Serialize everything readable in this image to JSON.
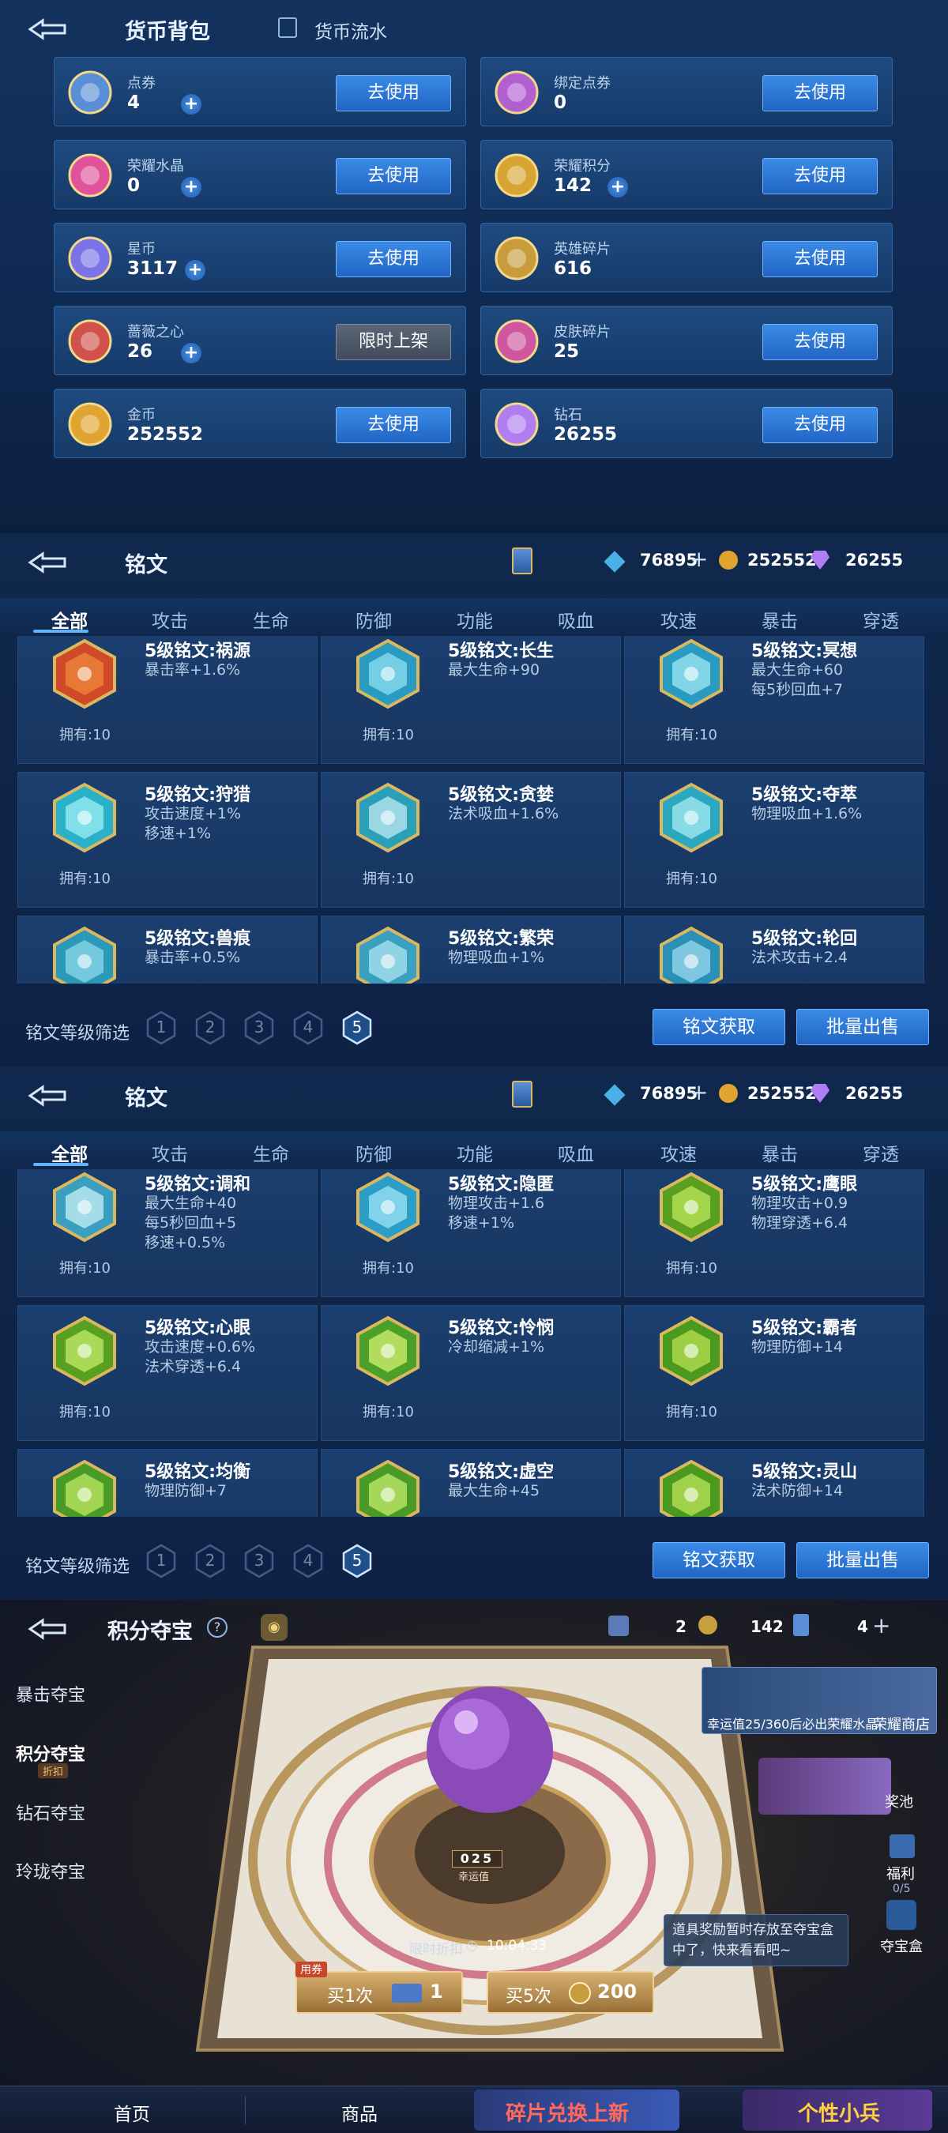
{
  "currency_panel": {
    "title": "货币背包",
    "flow_tab": "货币流水",
    "items": [
      {
        "name": "点券",
        "value": "4",
        "button": "去使用",
        "plus": true,
        "icon": "coupon-icon",
        "color": "#5a8fd8"
      },
      {
        "name": "绑定点券",
        "value": "0",
        "button": "去使用",
        "plus": false,
        "icon": "bound-coupon-icon",
        "color": "#b25fd0"
      },
      {
        "name": "荣耀水晶",
        "value": "0",
        "button": "去使用",
        "plus": true,
        "icon": "crystal-icon",
        "color": "#e0539a"
      },
      {
        "name": "荣耀积分",
        "value": "142",
        "button": "去使用",
        "plus": true,
        "icon": "honor-points-icon",
        "color": "#d9a532"
      },
      {
        "name": "星币",
        "value": "3117",
        "button": "去使用",
        "plus": true,
        "icon": "star-coin-icon",
        "color": "#7b74e8"
      },
      {
        "name": "英雄碎片",
        "value": "616",
        "button": "去使用",
        "plus": false,
        "icon": "hero-fragment-icon",
        "color": "#c89b3c"
      },
      {
        "name": "蔷薇之心",
        "value": "26",
        "button": "限时上架",
        "plus": true,
        "icon": "rose-heart-icon",
        "color": "#d0524a"
      },
      {
        "name": "皮肤碎片",
        "value": "25",
        "button": "去使用",
        "plus": false,
        "icon": "skin-fragment-icon",
        "color": "#d056a0"
      },
      {
        "name": "金币",
        "value": "252552",
        "button": "去使用",
        "plus": false,
        "icon": "gold-coin-icon",
        "color": "#e0a530"
      },
      {
        "name": "钻石",
        "value": "26255",
        "button": "去使用",
        "plus": false,
        "icon": "diamond-icon",
        "color": "#b07ef0"
      }
    ]
  },
  "rune_header": {
    "title": "铭文",
    "crystal": "76895",
    "gold": "252552",
    "diamond": "26255",
    "tabs": [
      "全部",
      "攻击",
      "生命",
      "防御",
      "功能",
      "吸血",
      "攻速",
      "暴击",
      "穿透"
    ],
    "filter_label": "铭文等级筛选",
    "levels": [
      "1",
      "2",
      "3",
      "4",
      "5"
    ],
    "btn_get": "铭文获取",
    "btn_sell": "批量出售"
  },
  "runes_a": [
    {
      "name": "5级铭文:祸源",
      "desc": [
        "暴击率+1.6%"
      ],
      "own": "拥有:10",
      "color": "#d04a2a",
      "inner": "#f08a3a"
    },
    {
      "name": "5级铭文:长生",
      "desc": [
        "最大生命+90"
      ],
      "own": "拥有:10",
      "color": "#2a9bc0",
      "inner": "#8ee0f0"
    },
    {
      "name": "5级铭文:冥想",
      "desc": [
        "最大生命+60",
        "每5秒回血+7"
      ],
      "own": "拥有:10",
      "color": "#2a9bc0",
      "inner": "#a0e8f4"
    },
    {
      "name": "5级铭文:狩猎",
      "desc": [
        "攻击速度+1%",
        "移速+1%"
      ],
      "own": "拥有:10",
      "color": "#2ab0c8",
      "inner": "#9ef0f6"
    },
    {
      "name": "5级铭文:贪婪",
      "desc": [
        "法术吸血+1.6%"
      ],
      "own": "拥有:10",
      "color": "#2aa0b8",
      "inner": "#bfeaf0"
    },
    {
      "name": "5级铭文:夺萃",
      "desc": [
        "物理吸血+1.6%"
      ],
      "own": "拥有:10",
      "color": "#2aa8c0",
      "inner": "#a8ecf2"
    },
    {
      "name": "5级铭文:兽痕",
      "desc": [
        "暴击率+0.5%"
      ],
      "own": "",
      "color": "#2a9ab8",
      "inner": "#8ed8e8"
    },
    {
      "name": "5级铭文:繁荣",
      "desc": [
        "物理吸血+1%"
      ],
      "own": "",
      "color": "#3aa0c0",
      "inner": "#aee4f0"
    },
    {
      "name": "5级铭文:轮回",
      "desc": [
        "法术攻击+2.4"
      ],
      "own": "",
      "color": "#2a90b8",
      "inner": "#9cd8ee"
    }
  ],
  "runes_b": [
    {
      "name": "5级铭文:调和",
      "desc": [
        "最大生命+40",
        "每5秒回血+5",
        "移速+0.5%"
      ],
      "own": "拥有:10",
      "color": "#3a9ec0",
      "inner": "#c8f0f6"
    },
    {
      "name": "5级铭文:隐匿",
      "desc": [
        "物理攻击+1.6",
        "移速+1%"
      ],
      "own": "拥有:10",
      "color": "#2a9ec8",
      "inner": "#9ee4f4"
    },
    {
      "name": "5级铭文:鹰眼",
      "desc": [
        "物理攻击+0.9",
        "物理穿透+6.4"
      ],
      "own": "拥有:10",
      "color": "#5aa020",
      "inner": "#bce85a"
    },
    {
      "name": "5级铭文:心眼",
      "desc": [
        "攻击速度+0.6%",
        "法术穿透+6.4"
      ],
      "own": "拥有:10",
      "color": "#5aa020",
      "inner": "#c4ec6a"
    },
    {
      "name": "5级铭文:怜悯",
      "desc": [
        "冷却缩减+1%"
      ],
      "own": "拥有:10",
      "color": "#4aa028",
      "inner": "#d4f070"
    },
    {
      "name": "5级铭文:霸者",
      "desc": [
        "物理防御+14"
      ],
      "own": "拥有:10",
      "color": "#4a9a20",
      "inner": "#b8e050"
    },
    {
      "name": "5级铭文:均衡",
      "desc": [
        "物理防御+7"
      ],
      "own": "",
      "color": "#4a9a28",
      "inner": "#c0e860"
    },
    {
      "name": "5级铭文:虚空",
      "desc": [
        "最大生命+45"
      ],
      "own": "",
      "color": "#4a9a28",
      "inner": "#c4ec68"
    },
    {
      "name": "5级铭文:灵山",
      "desc": [
        "法术防御+14"
      ],
      "own": "",
      "color": "#4a9a20",
      "inner": "#bce458"
    }
  ],
  "treasure": {
    "title": "积分夺宝",
    "top_count1": "2",
    "top_count2": "142",
    "top_count3": "4",
    "side_tabs": [
      "暴击夺宝",
      "积分夺宝",
      "钻石夺宝",
      "玲珑夺宝"
    ],
    "side_badge": "折扣",
    "luck_text": "幸运值25/360后必出荣耀水晶",
    "honor_shop": "荣耀商店",
    "pool": "奖池",
    "welfare": "福利",
    "welfare_count": "0/5",
    "treasure_box": "夺宝盒",
    "notice": "道具奖励暂时存放至夺宝盒中了，快来看看吧~",
    "luck_value": "025",
    "luck_label": "幸运值",
    "discount_text": "限时折扣",
    "timer": "10:04:33",
    "coupon_tag": "用券",
    "buy1": "买1次",
    "buy1_cost": "1",
    "buy5": "买5次",
    "buy5_cost": "200",
    "nav": [
      "首页",
      "商品",
      "碎片兑换上新",
      "个性小兵"
    ]
  }
}
